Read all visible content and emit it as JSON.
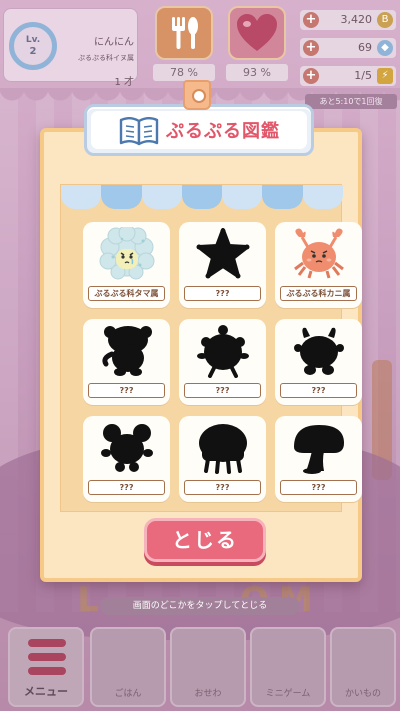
{
  "hud": {
    "player_name": "にんにん",
    "player_title": "ぷるぷる科イヌ属",
    "player_age": "1 才",
    "level_label": "Lv.",
    "level_value": "2",
    "food_percent": "78 %",
    "heart_percent": "93 %",
    "coins": "3,420",
    "gems": "69",
    "energy": "1/5",
    "timer_text": "あと5:10で1回復",
    "plus_symbol": "+"
  },
  "modal": {
    "title": "ぷるぷる図鑑",
    "close_label": "とじる",
    "entries": [
      {
        "name": "ぷるぷる科タマ属",
        "discovered": true,
        "icon": "fluffy-blob-icon"
      },
      {
        "name": "???",
        "discovered": false,
        "icon": "star-silhouette-icon"
      },
      {
        "name": "ぷるぷる科カニ属",
        "discovered": true,
        "icon": "crab-icon"
      },
      {
        "name": "???",
        "discovered": false,
        "icon": "mushroom-creature-silhouette-icon"
      },
      {
        "name": "???",
        "discovered": false,
        "icon": "round-creature-silhouette-icon"
      },
      {
        "name": "???",
        "discovered": false,
        "icon": "horned-creature-silhouette-icon"
      },
      {
        "name": "???",
        "discovered": false,
        "icon": "mouse-silhouette-icon"
      },
      {
        "name": "???",
        "discovered": false,
        "icon": "jellyfish-silhouette-icon"
      },
      {
        "name": "???",
        "discovered": false,
        "icon": "mushroom-silhouette-icon"
      }
    ]
  },
  "hint": "画面のどこかをタップしてとじる",
  "bottom_nav": {
    "menu_label": "メニュー",
    "items": [
      "ごはん",
      "おせわ",
      "ミニゲーム",
      "かいもの"
    ]
  },
  "colors": {
    "title_red": "#e2566a",
    "close_button": "#ea6a7d",
    "modal_bg": "#fce6c2"
  }
}
